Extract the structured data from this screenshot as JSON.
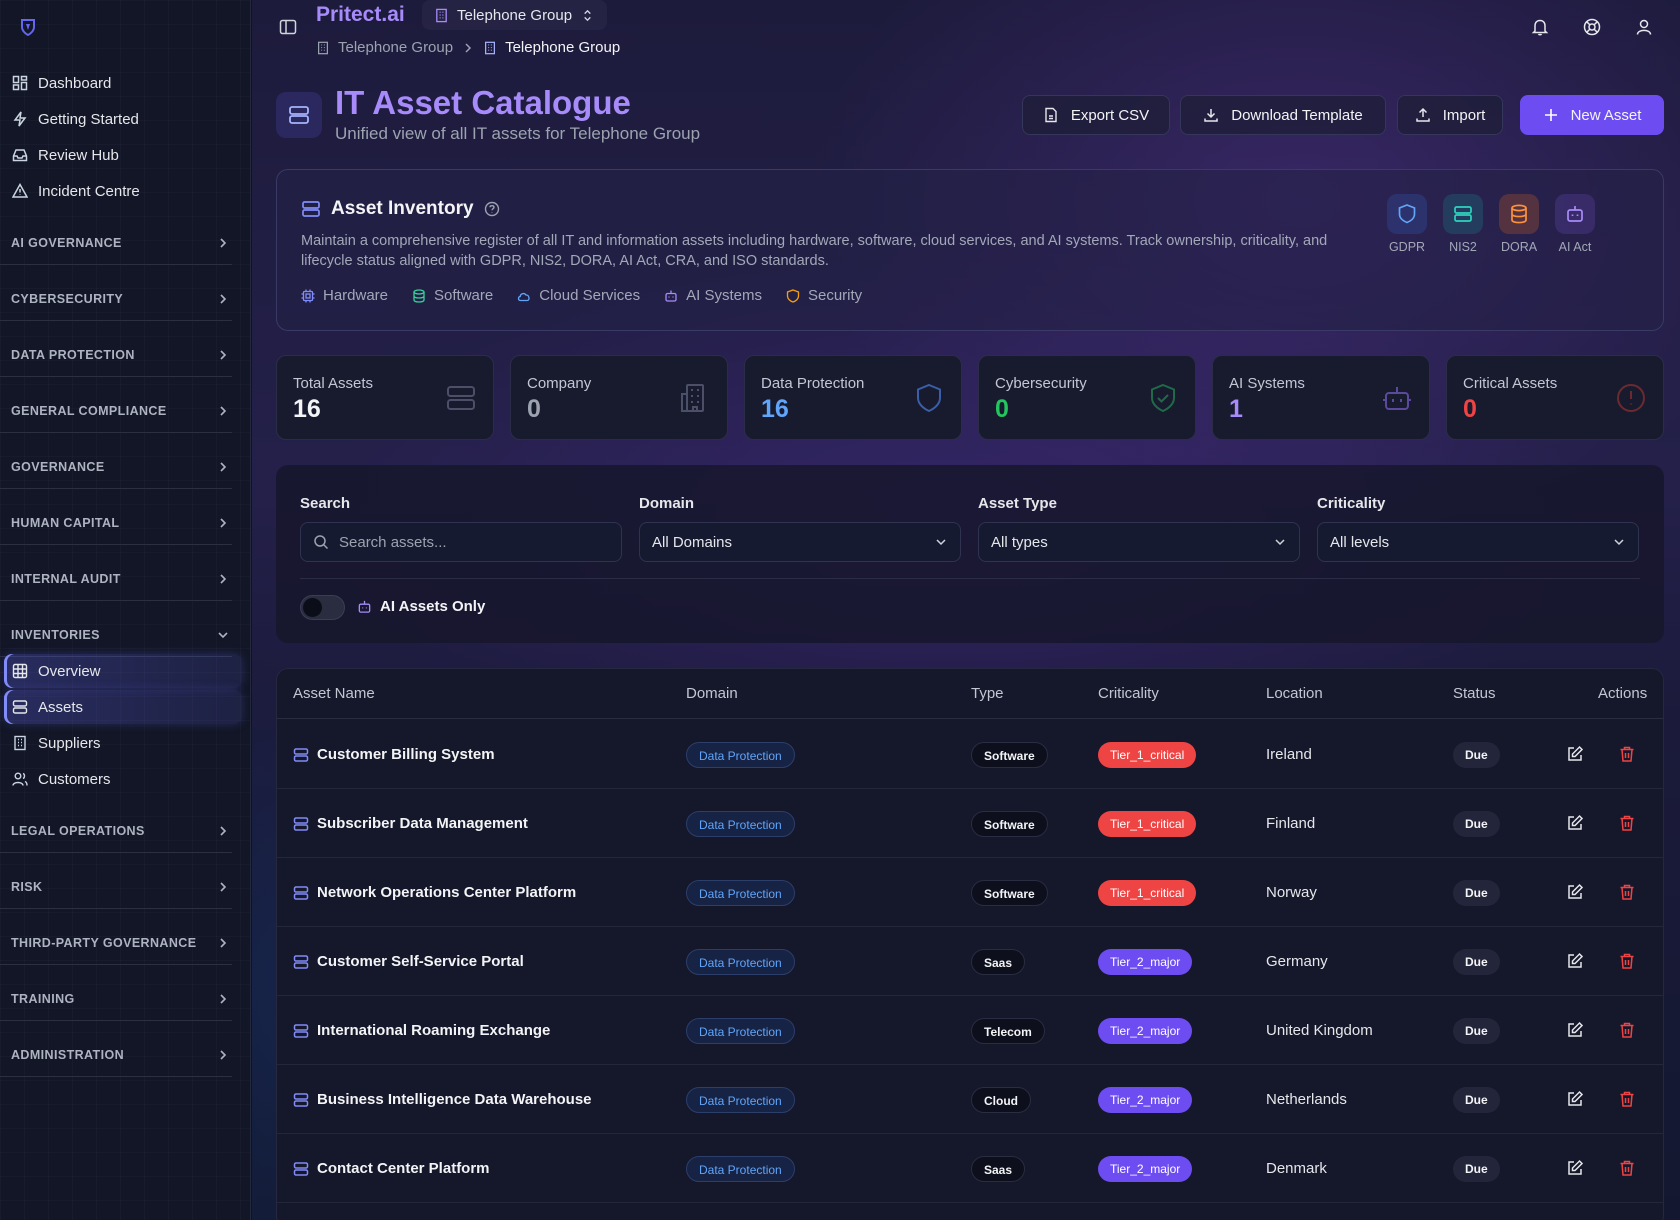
{
  "app": {
    "brand": "Pritect.ai",
    "group": "Telephone Group"
  },
  "breadcrumb": {
    "first": "Telephone Group",
    "current": "Telephone Group"
  },
  "sidebar": {
    "top_links": [
      "Dashboard",
      "Getting Started",
      "Review Hub",
      "Incident Centre"
    ],
    "sections": {
      "ai_governance": "AI GOVERNANCE",
      "cybersecurity": "CYBERSECURITY",
      "data_protection": "DATA PROTECTION",
      "general_compliance": "GENERAL COMPLIANCE",
      "governance": "GOVERNANCE",
      "human_capital": "HUMAN CAPITAL",
      "internal_audit": "INTERNAL AUDIT",
      "inventories": "INVENTORIES",
      "legal_operations": "LEGAL OPERATIONS",
      "risk": "RISK",
      "third_party_governance": "THIRD-PARTY GOVERNANCE",
      "training": "TRAINING",
      "administration": "ADMINISTRATION"
    },
    "inventory_items": [
      "Overview",
      "Assets",
      "Suppliers",
      "Customers"
    ]
  },
  "page": {
    "title": "IT Asset Catalogue",
    "subtitle": "Unified view of all IT assets for Telephone Group",
    "buttons": {
      "export": "Export CSV",
      "template": "Download Template",
      "import": "Import",
      "new": "New Asset"
    }
  },
  "inventory": {
    "title": "Asset Inventory",
    "description": "Maintain a comprehensive register of all IT and information assets including hardware, software, cloud services, and AI systems. Track ownership, criticality, and lifecycle status aligned with GDPR, NIS2, DORA, AI Act, CRA, and ISO standards.",
    "tags": [
      "Hardware",
      "Software",
      "Cloud Services",
      "AI Systems",
      "Security"
    ],
    "regulations": [
      "GDPR",
      "NIS2",
      "DORA",
      "AI Act"
    ]
  },
  "stats": [
    {
      "label": "Total Assets",
      "value": "16"
    },
    {
      "label": "Company",
      "value": "0"
    },
    {
      "label": "Data Protection",
      "value": "16"
    },
    {
      "label": "Cybersecurity",
      "value": "0"
    },
    {
      "label": "AI Systems",
      "value": "1"
    },
    {
      "label": "Critical Assets",
      "value": "0"
    }
  ],
  "filters": {
    "search_label": "Search",
    "search_placeholder": "Search assets...",
    "domain_label": "Domain",
    "domain_value": "All Domains",
    "type_label": "Asset Type",
    "type_value": "All types",
    "criticality_label": "Criticality",
    "criticality_value": "All levels",
    "ai_only_label": "AI Assets Only"
  },
  "table": {
    "headers": [
      "Asset Name",
      "Domain",
      "Type",
      "Criticality",
      "Location",
      "Status",
      "Actions"
    ],
    "rows": [
      {
        "name": "Customer Billing System",
        "domain": "Data Protection",
        "type": "Software",
        "criticality": "Tier_1_critical",
        "location": "Ireland",
        "status": "Due"
      },
      {
        "name": "Subscriber Data Management",
        "domain": "Data Protection",
        "type": "Software",
        "criticality": "Tier_1_critical",
        "location": "Finland",
        "status": "Due"
      },
      {
        "name": "Network Operations Center Platform",
        "domain": "Data Protection",
        "type": "Software",
        "criticality": "Tier_1_critical",
        "location": "Norway",
        "status": "Due"
      },
      {
        "name": "Customer Self-Service Portal",
        "domain": "Data Protection",
        "type": "Saas",
        "criticality": "Tier_2_major",
        "location": "Germany",
        "status": "Due"
      },
      {
        "name": "International Roaming Exchange",
        "domain": "Data Protection",
        "type": "Telecom",
        "criticality": "Tier_2_major",
        "location": "United Kingdom",
        "status": "Due"
      },
      {
        "name": "Business Intelligence Data Warehouse",
        "domain": "Data Protection",
        "type": "Cloud",
        "criticality": "Tier_2_major",
        "location": "Netherlands",
        "status": "Due"
      },
      {
        "name": "Contact Center Platform",
        "domain": "Data Protection",
        "type": "Saas",
        "criticality": "Tier_2_major",
        "location": "Denmark",
        "status": "Due"
      }
    ]
  },
  "colors": {
    "accent": "#6d4df2",
    "title": "#a78bfa",
    "critical": "#ef4444",
    "domain_blue": "#60a5fa"
  }
}
